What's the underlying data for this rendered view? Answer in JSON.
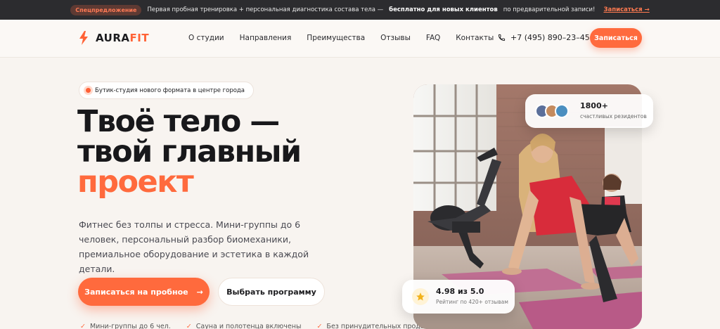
{
  "promo": {
    "tag": "Спецпредложение",
    "text_before": "Первая пробная тренировка + персональная диагностика состава тела —",
    "text_bold": "бесплатно для новых клиентов",
    "text_after": "по предварительной записи!",
    "link": "Записаться →"
  },
  "nav": {
    "logo_main": "AURA",
    "logo_accent": "FIT",
    "items": [
      "О студии",
      "Направления",
      "Преимущества",
      "Отзывы",
      "FAQ",
      "Контакты"
    ],
    "phone": "+7 (495) 890–23–45",
    "cta": "Записаться"
  },
  "hero": {
    "badge": "Бутик-студия нового формата в центре города",
    "title_line1": "Твоё тело —",
    "title_line2": "твой главный",
    "title_accent": "проект",
    "lead": "Фитнес без толпы и стресса. Мини-группы до 6 человек, персональный разбор биомеханики, премиальное оборудование и эстетика в каждой детали.",
    "btn_primary": "Записаться на пробное",
    "btn_primary_arrow": "→",
    "btn_secondary": "Выбрать программу",
    "features": [
      "Мини-группы до 6 чел.",
      "Сауна и полотенца включены",
      "Без принудительных продаж"
    ]
  },
  "stats": {
    "count": "1800+",
    "label": "счастливых резидентов"
  },
  "rating": {
    "value": "4.98 из 5.0",
    "label": "Рейтинг по 420+ отзывам"
  },
  "colors": {
    "accent": "#ff6a3d",
    "dark": "#18181b",
    "promo_bg": "#2c2c2f",
    "page_bg": "#f8f4f0"
  }
}
